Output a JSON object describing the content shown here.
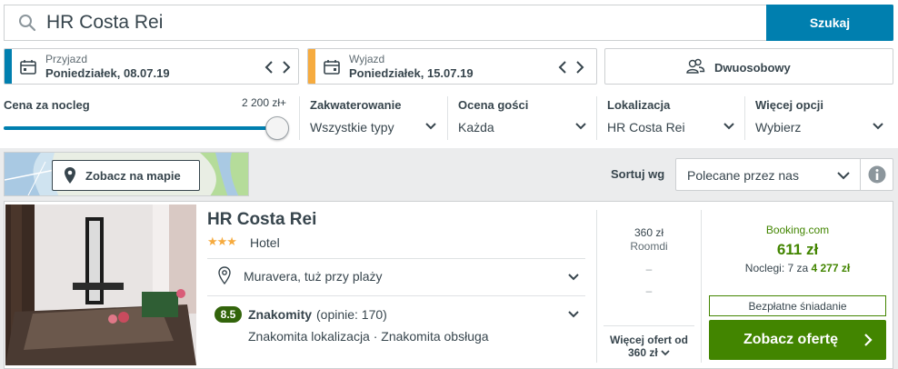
{
  "search": {
    "value": "HR Costa Rei",
    "button_label": "Szukaj"
  },
  "checkin": {
    "label": "Przyjazd",
    "value": "Poniedziałek, 08.07.19",
    "accent": "#007faf"
  },
  "checkout": {
    "label": "Wyjazd",
    "value": "Poniedziałek, 15.07.19",
    "accent": "#f6ab3f"
  },
  "guests": {
    "value": "Dwuosobowy"
  },
  "filters": {
    "price": {
      "label": "Cena za nocleg",
      "max": "2 200 zł+",
      "fill_fraction": 1.0
    },
    "lodging": {
      "title": "Zakwaterowanie",
      "value": "Wszystkie typy"
    },
    "rating": {
      "title": "Ocena gości",
      "value": "Każda"
    },
    "location": {
      "title": "Lokalizacja",
      "value": "HR Costa Rei"
    },
    "more": {
      "title": "Więcej opcji",
      "value": "Wybierz"
    }
  },
  "map": {
    "button_label": "Zobacz na mapie"
  },
  "sort": {
    "label": "Sortuj wg",
    "value": "Polecane przez nas"
  },
  "result": {
    "name": "HR Costa Rei",
    "stars": "★★★",
    "type": "Hotel",
    "location": "Muravera, tuż przy plaży",
    "rating_score": "8.5",
    "rating_word": "Znakomity",
    "rating_count": "(opinie: 170)",
    "rating_details": "Znakomita lokalizacja · Znakomita obsługa",
    "alt_offers": [
      {
        "price": "360 zł",
        "site": "Roomdi"
      },
      {
        "price": "–"
      },
      {
        "price": "–"
      }
    ],
    "more_offers_line1": "Więcej ofert od",
    "more_offers_line2": "360 zł",
    "best": {
      "site": "Booking.com",
      "price": "611 zł",
      "nights_prefix": "Noclegi: 7 za ",
      "nights_total": "4 277 zł",
      "breakfast": "Bezpłatne śniadanie",
      "button_label": "Zobacz ofertę"
    }
  },
  "colors": {
    "brand_blue": "#007faf",
    "deal_green": "#428500",
    "rating_green": "#32640b",
    "star_orange": "#f6ab3f"
  }
}
